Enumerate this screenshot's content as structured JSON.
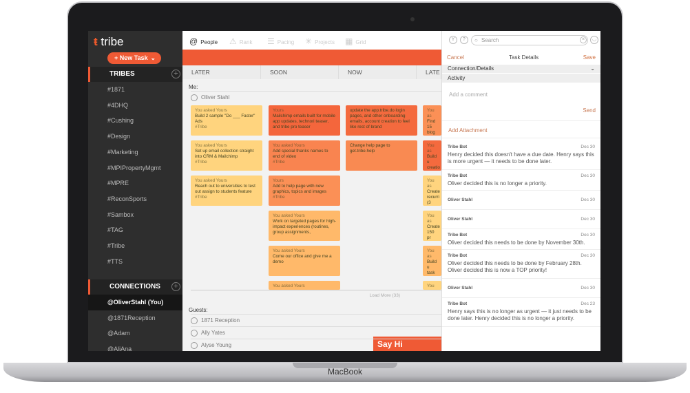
{
  "device": {
    "brand": "MacBook"
  },
  "sidebar": {
    "logo": "tribe",
    "new_task": "+ New Task",
    "tribes_title": "TRIBES",
    "tribes": [
      "#1871",
      "#4DHQ",
      "#Cushing",
      "#Design",
      "#Marketing",
      "#MPIPropertyMgmt",
      "#MPRE",
      "#ReconSports",
      "#Sambox",
      "#TAG",
      "#Tribe",
      "#TTS"
    ],
    "connections_title": "CONNECTIONS",
    "connections": [
      "@OliverStahl (You)",
      "@1871Reception",
      "@Adam",
      "@AliAna"
    ]
  },
  "nav": {
    "tabs": [
      {
        "icon": "@",
        "label": "People"
      },
      {
        "icon": "⚠",
        "label": "Rank"
      },
      {
        "icon": "☰",
        "label": "Pacing"
      },
      {
        "icon": "✳",
        "label": "Projects"
      },
      {
        "icon": "▦",
        "label": "Grid"
      }
    ]
  },
  "columns": [
    "LATER",
    "SOON",
    "NOW",
    "LATE"
  ],
  "me_label": "Me:",
  "me_name": "Oliver Stahl",
  "cards": [
    [
      {
        "h": "You asked Yours",
        "b": "Build 2 sample \"Do ___ Faster\" Ads",
        "t": "#Tribe",
        "c": "#ffd47e"
      },
      {
        "h": "You asked Yours",
        "b": "Set up email collection straight into CRM & Mailchimp",
        "t": "#Tribe",
        "c": "#ffd47e"
      },
      {
        "h": "You asked Yours",
        "b": "Reach out to universities to test out assign to students feature",
        "t": "#Tribe",
        "c": "#ffd47e"
      }
    ],
    [
      {
        "h": "Yours",
        "b": "Mailchimp emails built for mobile app updates, technori teaser, and tribe pro teaser",
        "t": "",
        "c": "#f4663c"
      },
      {
        "h": "You asked Yours",
        "b": "Add special thanks names to end of video",
        "t": "#Tribe",
        "c": "#f98450"
      },
      {
        "h": "Yours",
        "b": "Add to help page with new graphics, topics and images",
        "t": "#Tribe",
        "c": "#fb9056"
      },
      {
        "h": "You asked Yours",
        "b": "Work on targeted pages for high-impact experiences (routines, group assignments,",
        "t": "",
        "c": "#ffb96a"
      },
      {
        "h": "You asked Yours",
        "b": "Come our office and give me a demo",
        "t": "",
        "c": "#ffb96a"
      },
      {
        "h": "You asked Yours",
        "b": "",
        "t": "",
        "c": "#ffb96a"
      }
    ],
    [
      {
        "h": "",
        "b": "update the app.tribe.do login pages, and other onboarding emails, account creation to feel like rest of brand",
        "t": "",
        "c": "#f46a3e"
      },
      {
        "h": "",
        "b": "Change help page to get.tribe.help",
        "t": "",
        "c": "#f98a52"
      }
    ],
    [
      {
        "h": "You as",
        "b": "Find 15 blog ar (10 WE",
        "t": "",
        "c": "#fb9056"
      },
      {
        "h": "You as",
        "b": "Build u creatio",
        "t": "#Tribe",
        "c": "#f46a3e"
      },
      {
        "h": "You as",
        "b": "Create recurri (3 WEE",
        "t": "",
        "c": "#ffd47e"
      },
      {
        "h": "You as",
        "b": "Create 150 pr we sho",
        "t": "",
        "c": "#ffd47e"
      },
      {
        "h": "You as",
        "b": "Build u task cr",
        "t": "#Tribe",
        "c": "#ffb96a"
      },
      {
        "h": "You as",
        "b": "",
        "t": "",
        "c": "#ffd47e"
      }
    ]
  ],
  "load_more": "Load More (33)",
  "guests_label": "Guests:",
  "guests": [
    "1871 Reception",
    "Ally Yates",
    "Alyse Young"
  ],
  "say_hi": "Say Hi",
  "panel": {
    "search_placeholder": "Search",
    "cancel": "Cancel",
    "title": "Task Details",
    "save": "Save",
    "connection_details": "Connection/Details",
    "activity": "Activity",
    "comment_placeholder": "Add a comment",
    "send": "Send",
    "add_attachment": "Add Attachment",
    "activity_items": [
      {
        "who": "Tribe Bot",
        "date": "Dec 30",
        "text": "Henry decided this doesn't have a due date. Henry says this is more urgent — it needs to be done later."
      },
      {
        "who": "Tribe Bot",
        "date": "Dec 30",
        "text": "Oliver decided this is no longer a priority."
      },
      {
        "who": "Oliver Stahl",
        "date": "Dec 30",
        "text": ""
      },
      {
        "who": "Oliver Stahl",
        "date": "Dec 30",
        "text": ""
      },
      {
        "who": "Tribe Bot",
        "date": "Dec 30",
        "text": "Oliver decided this needs to be done by November 30th."
      },
      {
        "who": "Tribe Bot",
        "date": "Dec 30",
        "text": "Oliver decided this needs to be done by February 28th. Oliver decided this is now a TOP priority!"
      },
      {
        "who": "Oliver Stahl",
        "date": "Dec 30",
        "text": ""
      },
      {
        "who": "Tribe Bot",
        "date": "Dec 23",
        "text": "Henry says this is no longer as urgent — it just needs to be done later. Henry decided this is no longer a priority."
      }
    ]
  },
  "colors": {
    "accent": "#ef5a35",
    "sidebar": "#2e2e2e"
  }
}
